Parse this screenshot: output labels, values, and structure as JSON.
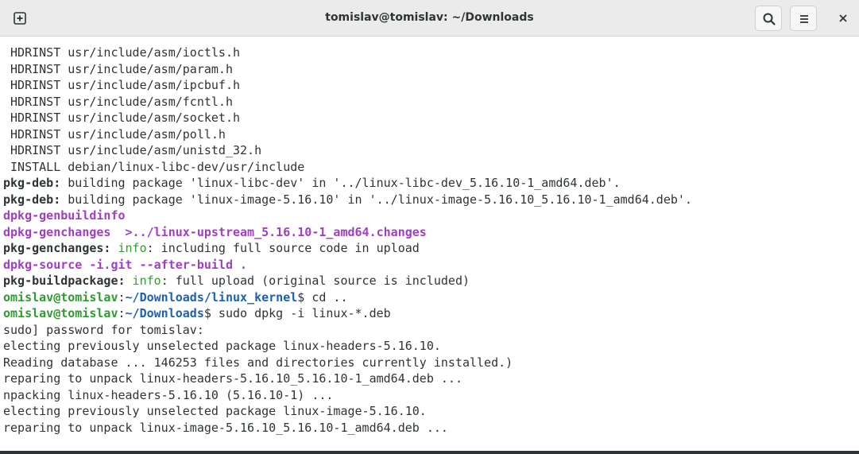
{
  "window": {
    "title": "tomislav@tomislav: ~/Downloads",
    "icons": {
      "new_tab": "new-tab-icon",
      "search": "search-icon",
      "menu": "hamburger-menu-icon",
      "close": "close-icon"
    }
  },
  "colors": {
    "titlebar": "#ebebeb",
    "text": "#2e3436",
    "magenta": "#a03ec4",
    "info_green": "#28a02a",
    "prompt_green": "#2f9a2f",
    "path_blue": "#1f5fb0"
  },
  "terminal": {
    "lines": [
      {
        "plain": " HDRINST usr/include/asm/ioctls.h"
      },
      {
        "plain": " HDRINST usr/include/asm/param.h"
      },
      {
        "plain": " HDRINST usr/include/asm/ipcbuf.h"
      },
      {
        "plain": " HDRINST usr/include/asm/fcntl.h"
      },
      {
        "plain": " HDRINST usr/include/asm/socket.h"
      },
      {
        "plain": " HDRINST usr/include/asm/poll.h"
      },
      {
        "plain": " HDRINST usr/include/asm/unistd_32.h"
      },
      {
        "plain": " INSTALL debian/linux-libc-dev/usr/include"
      },
      {
        "prefix": "pkg-deb:",
        "rest": " building package 'linux-libc-dev' in '../linux-libc-dev_5.16.10-1_amd64.deb'."
      },
      {
        "prefix": "pkg-deb:",
        "rest": " building package 'linux-image-5.16.10' in '../linux-image-5.16.10_5.16.10-1_amd64.deb'."
      },
      {
        "magenta": "dpkg-genbuildinfo"
      },
      {
        "magenta": "dpkg-genchanges  >../linux-upstream_5.16.10-1_amd64.changes"
      },
      {
        "prefix": "pkg-genchanges:",
        "info": " info",
        "rest": ": including full source code in upload"
      },
      {
        "magenta": "dpkg-source -i.git --after-build ."
      },
      {
        "prefix": "pkg-buildpackage:",
        "info": " info",
        "rest": ": full upload (original source is included)"
      },
      {
        "user": "omislav@tomislav",
        "colon": ":",
        "path": "~/Downloads/linux_kernel",
        "rest": "$ cd .."
      },
      {
        "user": "omislav@tomislav",
        "colon": ":",
        "path": "~/Downloads",
        "rest": "$ sudo dpkg -i linux-*.deb"
      },
      {
        "plain": "sudo] password for tomislav:"
      },
      {
        "plain": "electing previously unselected package linux-headers-5.16.10."
      },
      {
        "plain": "Reading database ... 146253 files and directories currently installed.)"
      },
      {
        "plain": "reparing to unpack linux-headers-5.16.10_5.16.10-1_amd64.deb ..."
      },
      {
        "plain": "npacking linux-headers-5.16.10 (5.16.10-1) ..."
      },
      {
        "plain": "electing previously unselected package linux-image-5.16.10."
      },
      {
        "plain": "reparing to unpack linux-image-5.16.10_5.16.10-1_amd64.deb ..."
      }
    ]
  }
}
